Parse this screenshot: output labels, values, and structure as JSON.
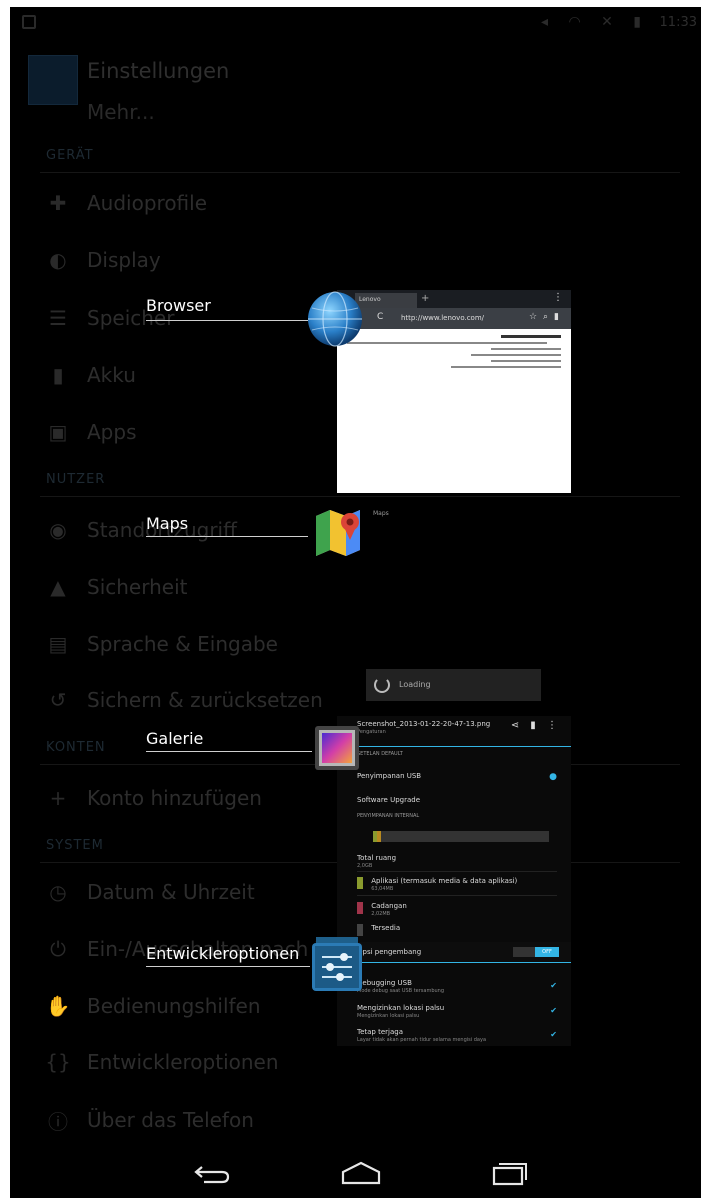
{
  "status_bar": {
    "time": "11:33"
  },
  "settings": {
    "title": "Einstellungen",
    "subtitle": "Mehr...",
    "sections": {
      "geraet": "GERÄT",
      "nutzer": "NUTZER",
      "konten": "KONTEN",
      "system": "SYSTEM"
    },
    "items": {
      "audioprofile": "Audioprofile",
      "display": "Display",
      "speicher": "Speicher",
      "akku": "Akku",
      "apps": "Apps",
      "standortzugriff": "Standortzugriff",
      "sicherheit": "Sicherheit",
      "sprache": "Sprache & Eingabe",
      "sichern": "Sichern & zurücksetzen",
      "konto_hinzufuegen": "Konto hinzufügen",
      "datum": "Datum & Uhrzeit",
      "einaus": "Ein-/Ausschalten nach Zeitplan",
      "bedienungshilfen": "Bedienungshilfen",
      "entwickleroptionen": "Entwickleroptionen",
      "ueber": "Über das Telefon"
    }
  },
  "recent_apps": [
    {
      "label": "Browser"
    },
    {
      "label": "Maps"
    },
    {
      "label": "Galerie"
    },
    {
      "label": "Entwickleroptionen"
    }
  ],
  "browser_thumb": {
    "url": "http://www.lenovo.com/",
    "tab_title": "Lenovo"
  },
  "maps_thumb": {
    "caption": "Maps"
  },
  "loading_thumb": {
    "text": "Loading"
  },
  "storage_thumb": {
    "header": "Screenshot_2013-01-22-20-47-13.png",
    "sub_header": "Pengaturan",
    "section": "SETELAN DEFAULT",
    "default_item": "Penyimpanan USB",
    "software_upgrade": "Software Upgrade",
    "internal": "PENYIMPANAN INTERNAL",
    "total_label": "Total ruang",
    "total_value": "2,0GB",
    "legend": [
      {
        "label": "Aplikasi (termasuk media & data aplikasi)",
        "value": "63,04MB",
        "color": "#8a9b2e"
      },
      {
        "label": "Cadangan",
        "value": "2,02MB",
        "color": "#a0344a"
      },
      {
        "label": "Tersedia",
        "value": "",
        "color": "#444444"
      }
    ],
    "dev_opts_label": "Opsi pengembang",
    "dev_opts_toggle": "OFF",
    "usb_debug": "Debugging USB",
    "usb_debug_sub": "Mode debug saat USB tersambung",
    "stay_awake": "Mengizinkan lokasi palsu",
    "stay_awake_sub": "Mengizinkan lokasi palsu",
    "desktop_backup": "Tetap terjaga",
    "desktop_backup_sub": "Layar tidak akan pernah tidur selama mengisi daya"
  }
}
